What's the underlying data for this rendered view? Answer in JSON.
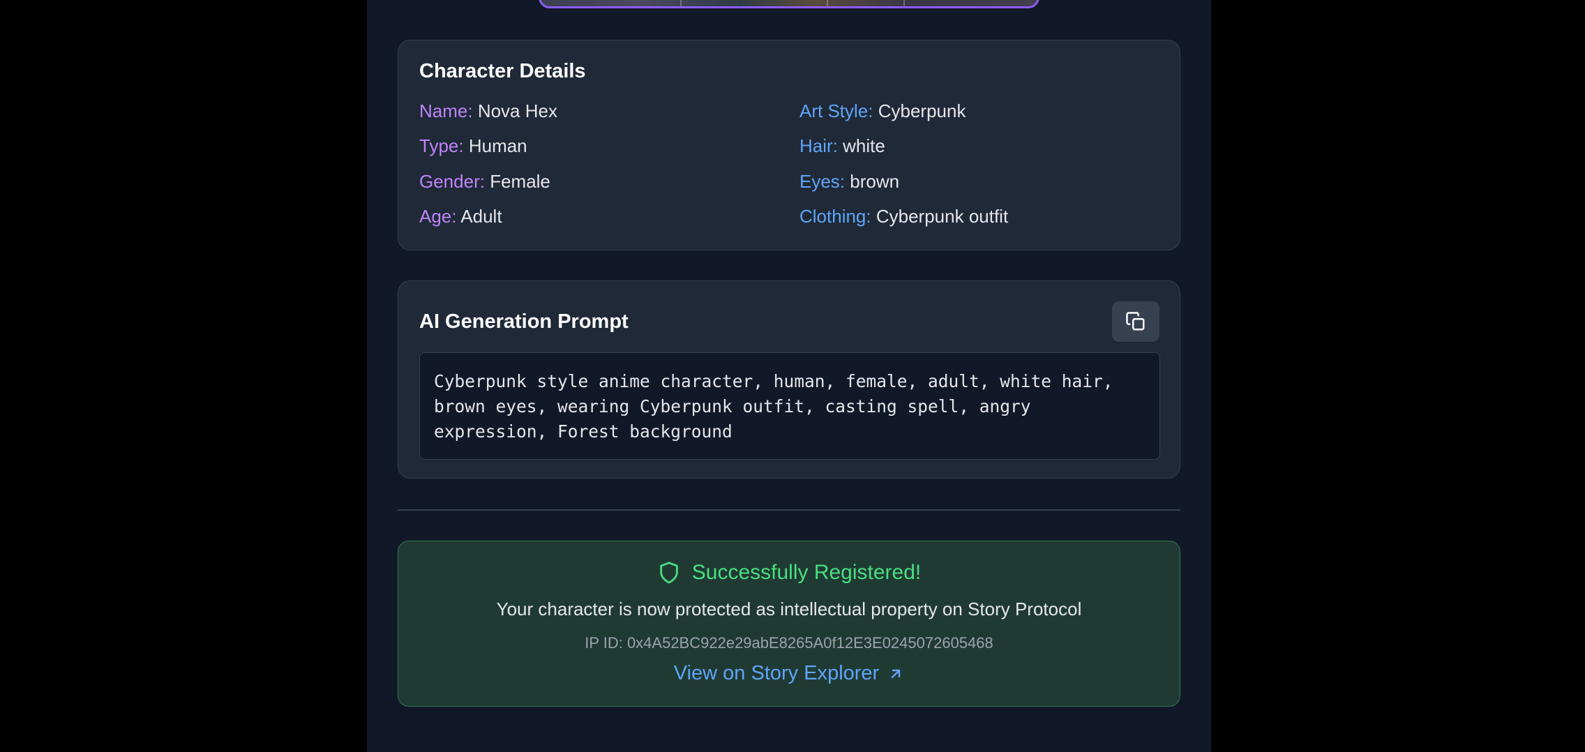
{
  "details": {
    "title": "Character Details",
    "left": [
      {
        "key": "Name:",
        "value": "Nova Hex"
      },
      {
        "key": "Type:",
        "value": "Human"
      },
      {
        "key": "Gender:",
        "value": "Female"
      },
      {
        "key": "Age:",
        "value": "Adult"
      }
    ],
    "right": [
      {
        "key": "Art Style:",
        "value": "Cyberpunk"
      },
      {
        "key": "Hair:",
        "value": "white"
      },
      {
        "key": "Eyes:",
        "value": "brown"
      },
      {
        "key": "Clothing:",
        "value": "Cyberpunk outfit"
      }
    ]
  },
  "prompt": {
    "title": "AI Generation Prompt",
    "copy_icon": "copy-icon",
    "text": "Cyberpunk style anime character, human, female, adult, white hair, brown eyes, wearing Cyberpunk outfit, casting spell, angry expression, Forest background"
  },
  "success": {
    "icon": "shield-icon",
    "title": "Successfully Registered!",
    "description": "Your character is now protected as intellectual property on Story Protocol",
    "ip_id": "IP ID: 0x4A52BC922e29abE8265A0f12E3E0245072605468",
    "link_label": "View on Story Explorer",
    "link_icon": "arrow-up-right-icon"
  },
  "colors": {
    "accent_purple": "#c084fc",
    "accent_blue": "#60a5fa",
    "success_green": "#4ade80"
  }
}
